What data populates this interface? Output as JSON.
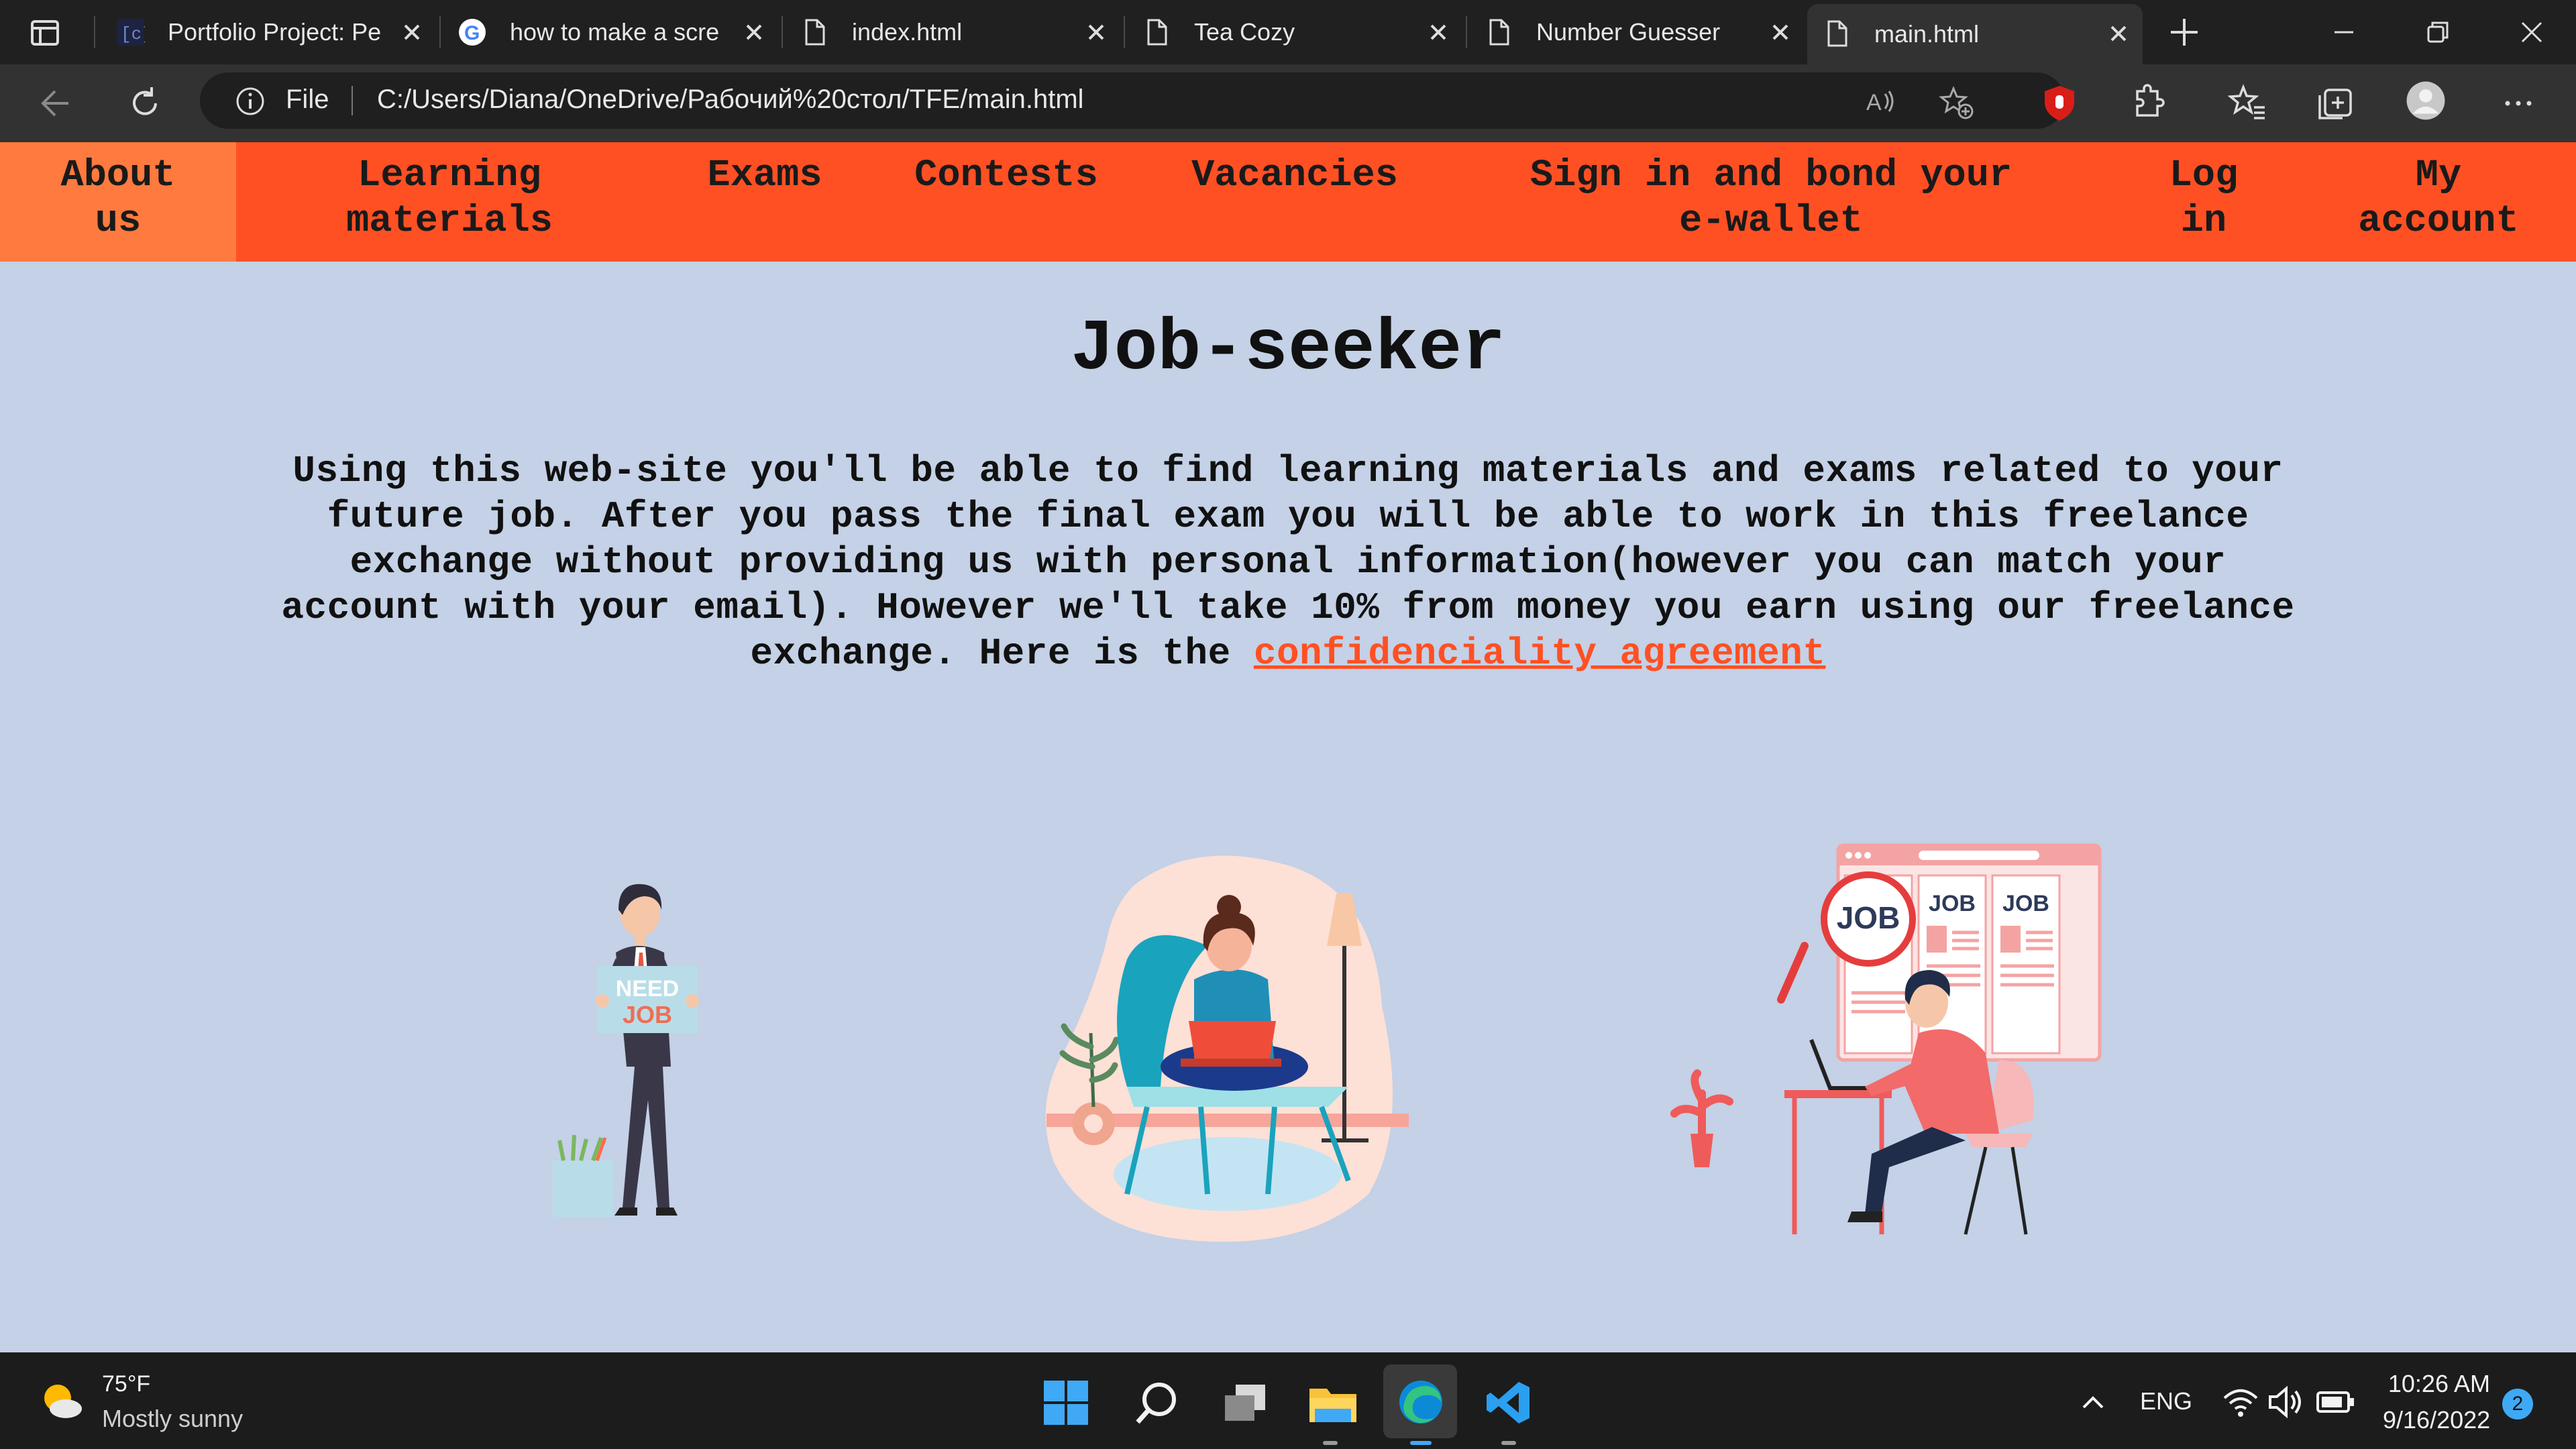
{
  "browser": {
    "tabs": [
      {
        "title": "Portfolio Project: Pe",
        "active": false
      },
      {
        "title": "how to make a scre",
        "active": false
      },
      {
        "title": "index.html",
        "active": false
      },
      {
        "title": "Tea Cozy",
        "active": false
      },
      {
        "title": "Number Guesser",
        "active": false
      },
      {
        "title": "main.html",
        "active": true
      }
    ],
    "address": {
      "scheme_label": "File",
      "url": "C:/Users/Diana/OneDrive/Рабочий%20стол/TFE/main.html"
    },
    "toolbar_icons": [
      "back-icon",
      "refresh-icon",
      "info-icon",
      "read-aloud-icon",
      "add-favorite-icon",
      "ublock-icon",
      "extensions-icon",
      "favorites-icon",
      "collections-icon",
      "profile-icon",
      "more-icon"
    ]
  },
  "site": {
    "nav": [
      {
        "label": "About\nus"
      },
      {
        "label": "Learning\nmaterials"
      },
      {
        "label": "Exams"
      },
      {
        "label": "Contests"
      },
      {
        "label": "Vacancies"
      },
      {
        "label": "Sign in and bond your\ne-wallet"
      },
      {
        "label": "Log\nin"
      },
      {
        "label": "My\naccount"
      }
    ],
    "heading": "Job-seeker",
    "intro_text": "Using this web-site you'll be able to find learning materials and exams related to your future job. After you pass the final exam you will be able to work in this freelance exchange without providing us with personal information(however you can match your account with your email). However we'll take 10% from money you earn using our freelance exchange. Here is the ",
    "intro_link": "confidenciality agreement",
    "illustrations": {
      "sign_top": "NEED",
      "sign_bottom": "JOB",
      "job_label": "JOB"
    },
    "colors": {
      "nav": "#ff5024",
      "nav_active": "#ff7a3e",
      "background": "#c4d1e6",
      "link": "#ff5024"
    }
  },
  "taskbar": {
    "weather_temp": "75°F",
    "weather_desc": "Mostly sunny",
    "language": "ENG",
    "time": "10:26 AM",
    "date": "9/16/2022",
    "notification_count": "2",
    "pinned": [
      "start-icon",
      "search-icon",
      "task-view-icon",
      "file-explorer-icon",
      "edge-icon",
      "vscode-icon"
    ]
  }
}
